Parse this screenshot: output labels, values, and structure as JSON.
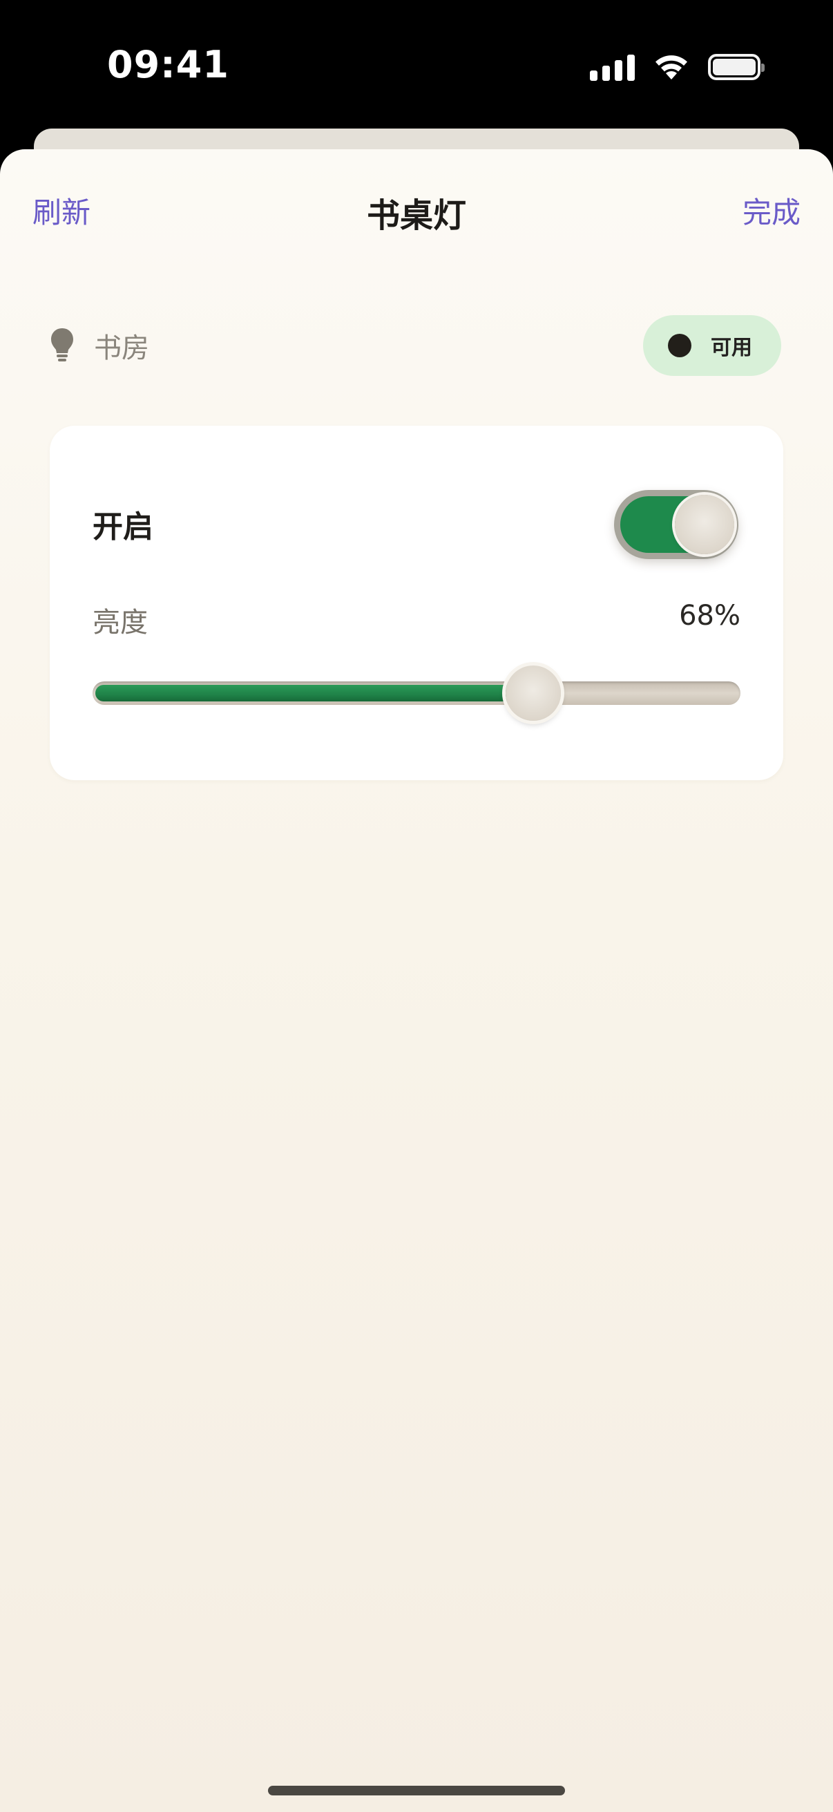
{
  "status_bar": {
    "time": "09:41",
    "icons": [
      "cellular-signal-icon",
      "wifi-icon",
      "battery-icon"
    ]
  },
  "nav": {
    "left_label": "刷新",
    "title": "书桌灯",
    "right_label": "完成"
  },
  "device": {
    "room_icon": "lightbulb-icon",
    "room": "书房",
    "availability": "可用"
  },
  "controls": {
    "power_label": "开启",
    "power_on": true,
    "brightness_label": "亮度",
    "brightness_text": "68%",
    "brightness_value": 68
  },
  "colors": {
    "accent": "#6a5bc8",
    "on_green": "#1e8a4c",
    "status_pill_bg": "#d8f0d8",
    "background": "#f9f4ea"
  }
}
